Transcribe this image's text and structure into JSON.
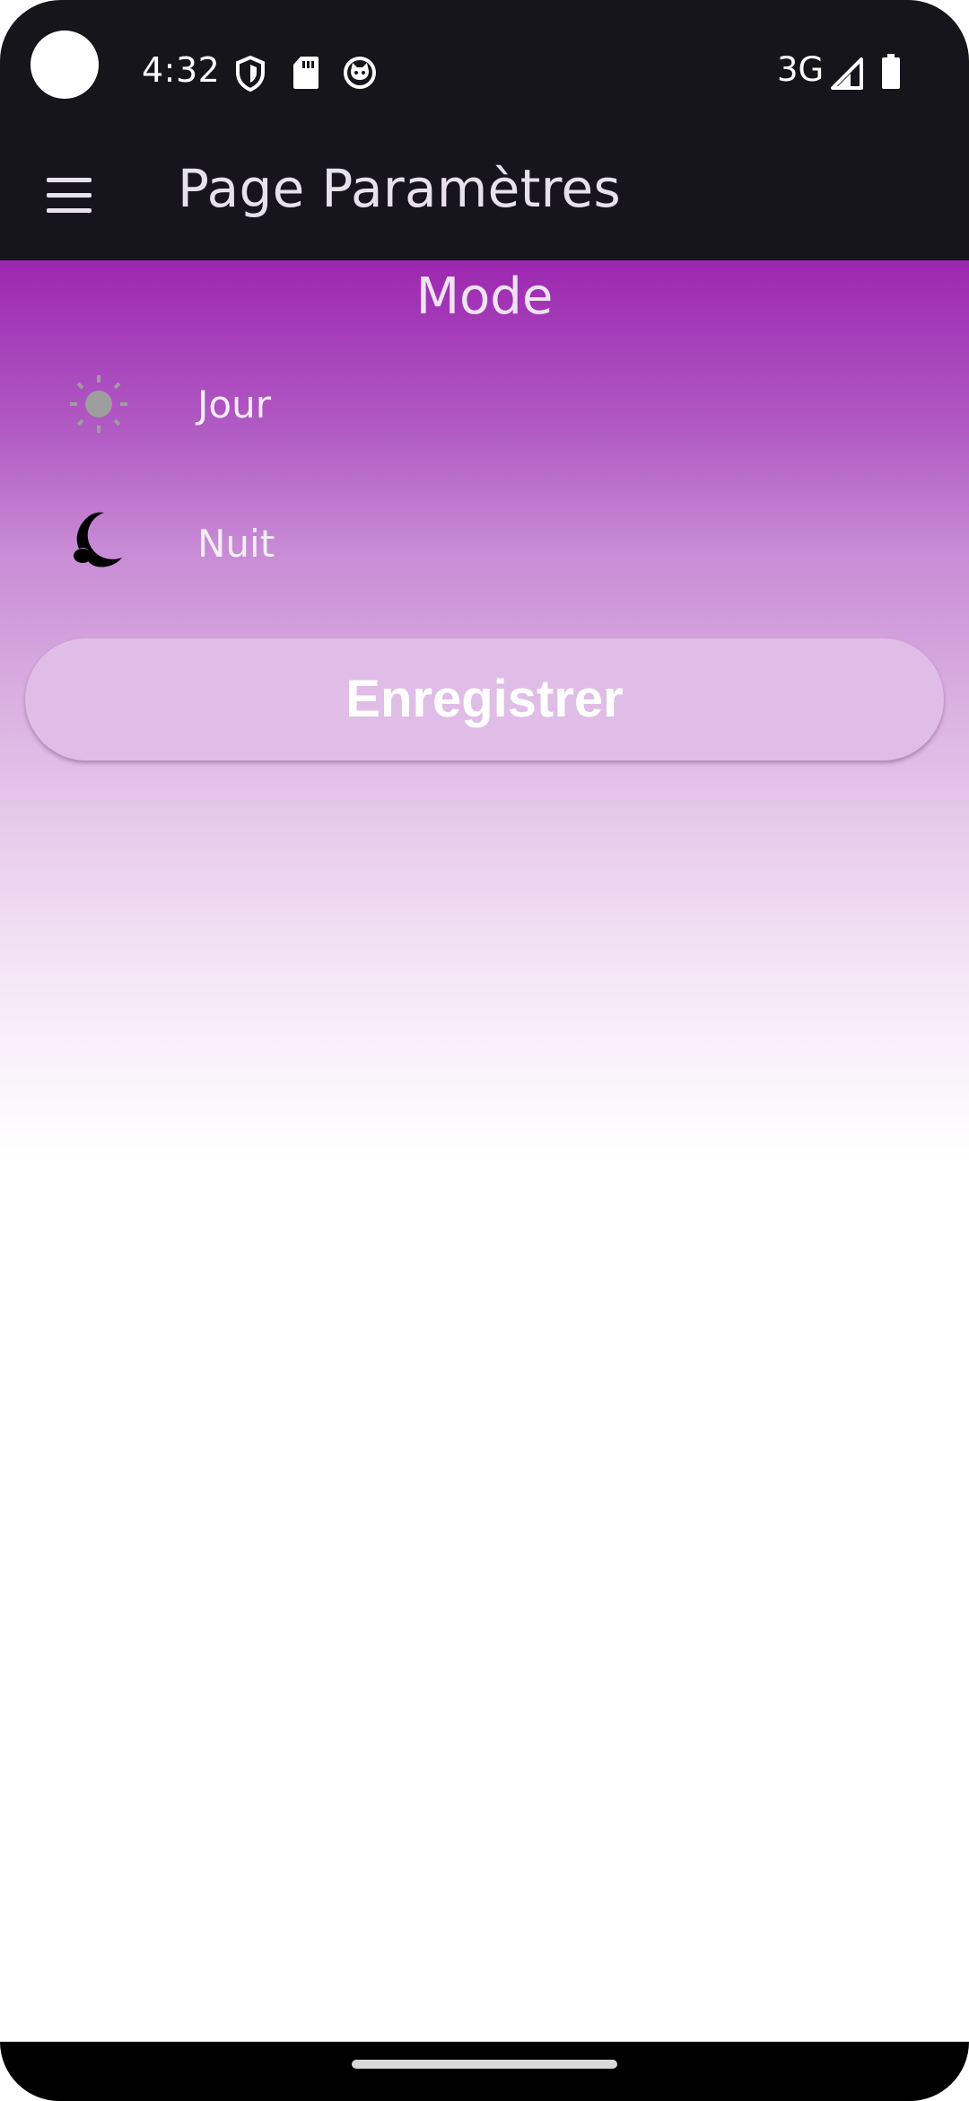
{
  "status_bar": {
    "time": "4:32",
    "network": "3G",
    "icons": [
      "shield-icon",
      "sd-card-icon",
      "cat-face-icon",
      "signal-icon",
      "battery-icon"
    ]
  },
  "app_bar": {
    "menu_icon": "hamburger-menu-icon",
    "title": "Page Paramètres"
  },
  "settings": {
    "section_title": "Mode",
    "options": [
      {
        "label": "Jour",
        "icon": "sun-icon",
        "icon_color": "#9e9e9e"
      },
      {
        "label": "Nuit",
        "icon": "moon-icon",
        "icon_color": "#000000"
      }
    ],
    "save_label": "Enregistrer"
  },
  "colors": {
    "app_bar_background": "#16151c",
    "gradient_start": "#9c27b0",
    "gradient_end": "#ffffff",
    "button_background": "#e0bde6",
    "text_light": "#e6e1ea"
  }
}
